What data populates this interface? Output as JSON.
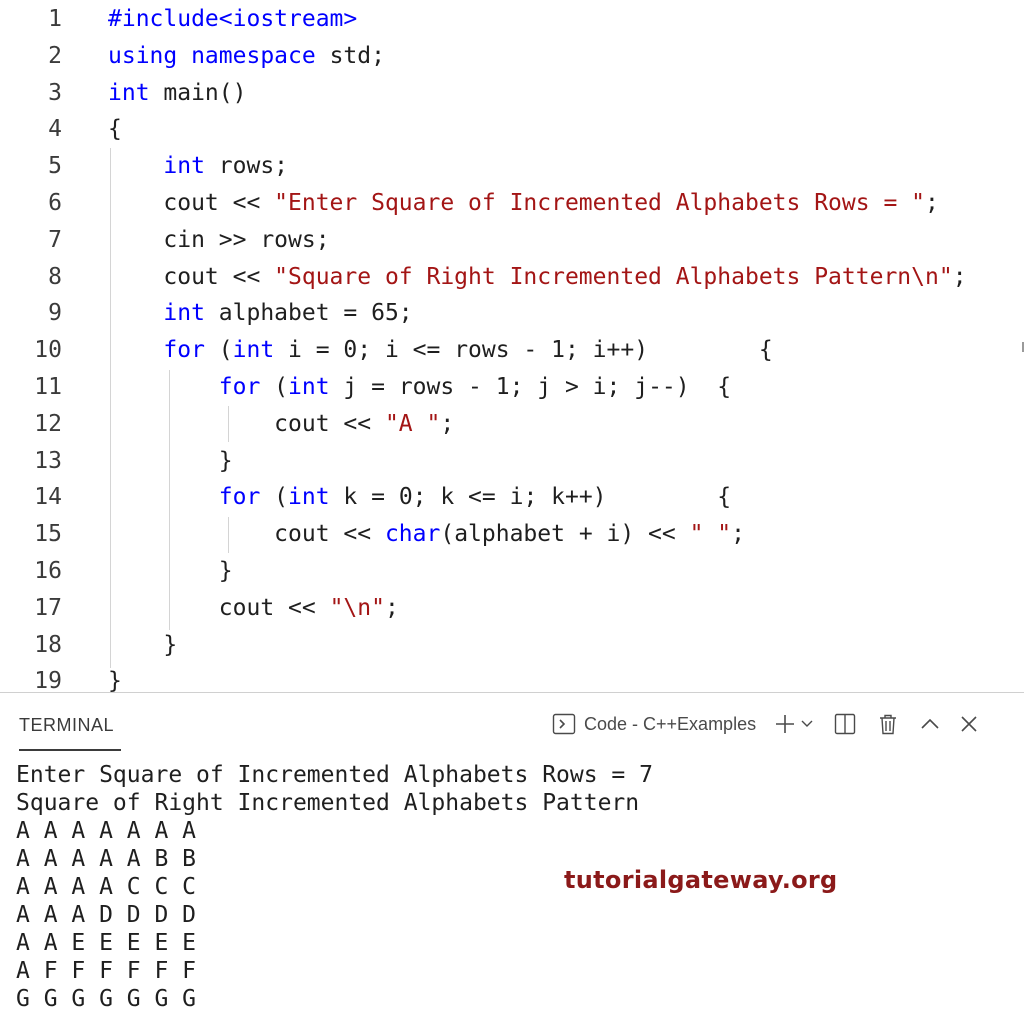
{
  "editor": {
    "lines": [
      {
        "n": "1",
        "parts": [
          {
            "t": "#include<iostream>",
            "c": "kw2"
          }
        ]
      },
      {
        "n": "2",
        "parts": [
          {
            "t": "using namespace",
            "c": "kw"
          },
          {
            "t": " std;",
            "c": ""
          }
        ]
      },
      {
        "n": "3",
        "parts": [
          {
            "t": "int",
            "c": "kw"
          },
          {
            "t": " main()",
            "c": ""
          }
        ]
      },
      {
        "n": "4",
        "parts": [
          {
            "t": "{",
            "c": ""
          }
        ]
      },
      {
        "n": "5",
        "parts": [
          {
            "t": "    ",
            "c": ""
          },
          {
            "t": "int",
            "c": "kw"
          },
          {
            "t": " rows;",
            "c": ""
          }
        ]
      },
      {
        "n": "6",
        "parts": [
          {
            "t": "    cout << ",
            "c": ""
          },
          {
            "t": "\"Enter Square of Incremented Alphabets Rows = \"",
            "c": "str"
          },
          {
            "t": ";",
            "c": ""
          }
        ]
      },
      {
        "n": "7",
        "parts": [
          {
            "t": "    cin >> rows;",
            "c": ""
          }
        ]
      },
      {
        "n": "8",
        "parts": [
          {
            "t": "    cout << ",
            "c": ""
          },
          {
            "t": "\"Square of Right Incremented Alphabets Pattern\\n\"",
            "c": "str"
          },
          {
            "t": ";",
            "c": ""
          }
        ]
      },
      {
        "n": "9",
        "parts": [
          {
            "t": "    ",
            "c": ""
          },
          {
            "t": "int",
            "c": "kw"
          },
          {
            "t": " alphabet = 65;",
            "c": ""
          }
        ]
      },
      {
        "n": "10",
        "parts": [
          {
            "t": "    ",
            "c": ""
          },
          {
            "t": "for",
            "c": "kw"
          },
          {
            "t": " (",
            "c": ""
          },
          {
            "t": "int",
            "c": "kw"
          },
          {
            "t": " i = 0; i <= rows - 1; i++)        {",
            "c": ""
          }
        ]
      },
      {
        "n": "11",
        "parts": [
          {
            "t": "        ",
            "c": ""
          },
          {
            "t": "for",
            "c": "kw"
          },
          {
            "t": " (",
            "c": ""
          },
          {
            "t": "int",
            "c": "kw"
          },
          {
            "t": " j = rows - 1; j > i; j--)  {",
            "c": ""
          }
        ]
      },
      {
        "n": "12",
        "parts": [
          {
            "t": "            cout << ",
            "c": ""
          },
          {
            "t": "\"A \"",
            "c": "str"
          },
          {
            "t": ";",
            "c": ""
          }
        ]
      },
      {
        "n": "13",
        "parts": [
          {
            "t": "        }",
            "c": ""
          }
        ]
      },
      {
        "n": "14",
        "parts": [
          {
            "t": "        ",
            "c": ""
          },
          {
            "t": "for",
            "c": "kw"
          },
          {
            "t": " (",
            "c": ""
          },
          {
            "t": "int",
            "c": "kw"
          },
          {
            "t": " k = 0; k <= i; k++)        {",
            "c": ""
          }
        ]
      },
      {
        "n": "15",
        "parts": [
          {
            "t": "            cout << ",
            "c": ""
          },
          {
            "t": "char",
            "c": "kw"
          },
          {
            "t": "(alphabet + i) << ",
            "c": ""
          },
          {
            "t": "\" \"",
            "c": "str"
          },
          {
            "t": ";",
            "c": ""
          }
        ]
      },
      {
        "n": "16",
        "parts": [
          {
            "t": "        }",
            "c": ""
          }
        ]
      },
      {
        "n": "17",
        "parts": [
          {
            "t": "        cout << ",
            "c": ""
          },
          {
            "t": "\"\\n\"",
            "c": "str"
          },
          {
            "t": ";",
            "c": ""
          }
        ]
      },
      {
        "n": "18",
        "parts": [
          {
            "t": "    }",
            "c": ""
          }
        ]
      },
      {
        "n": "19",
        "parts": [
          {
            "t": "}",
            "c": ""
          }
        ]
      }
    ]
  },
  "terminal": {
    "tab_label": "TERMINAL",
    "terminal_name": "Code - C++Examples",
    "output": [
      "Enter Square of Incremented Alphabets Rows = 7",
      "Square of Right Incremented Alphabets Pattern",
      "A A A A A A A",
      "A A A A A B B",
      "A A A A C C C",
      "A A A D D D D",
      "A A E E E E E",
      "A F F F F F F",
      "G G G G G G G"
    ]
  },
  "watermark": "tutorialgateway.org",
  "colors": {
    "keyword": "#0000ff",
    "string": "#a31515",
    "watermark": "#8b1a1a"
  }
}
